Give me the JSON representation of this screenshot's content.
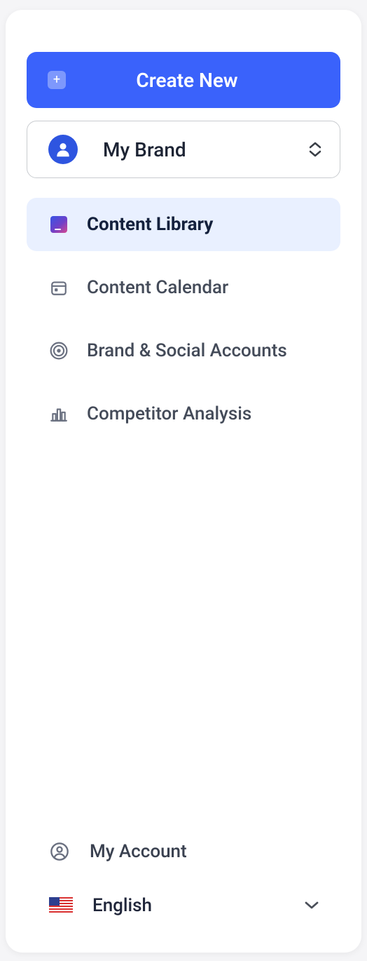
{
  "createButton": {
    "label": "Create New"
  },
  "brandSelector": {
    "label": "My Brand",
    "icon": "user-avatar-icon"
  },
  "nav": {
    "items": [
      {
        "label": "Content Library",
        "icon": "content-library-icon",
        "active": true
      },
      {
        "label": "Content Calendar",
        "icon": "calendar-icon",
        "active": false
      },
      {
        "label": "Brand & Social Accounts",
        "icon": "broadcast-icon",
        "active": false
      },
      {
        "label": "Competitor Analysis",
        "icon": "bar-chart-icon",
        "active": false
      }
    ]
  },
  "footer": {
    "account": {
      "label": "My Account",
      "icon": "account-icon"
    },
    "language": {
      "label": "English",
      "flag": "us-flag-icon"
    }
  }
}
